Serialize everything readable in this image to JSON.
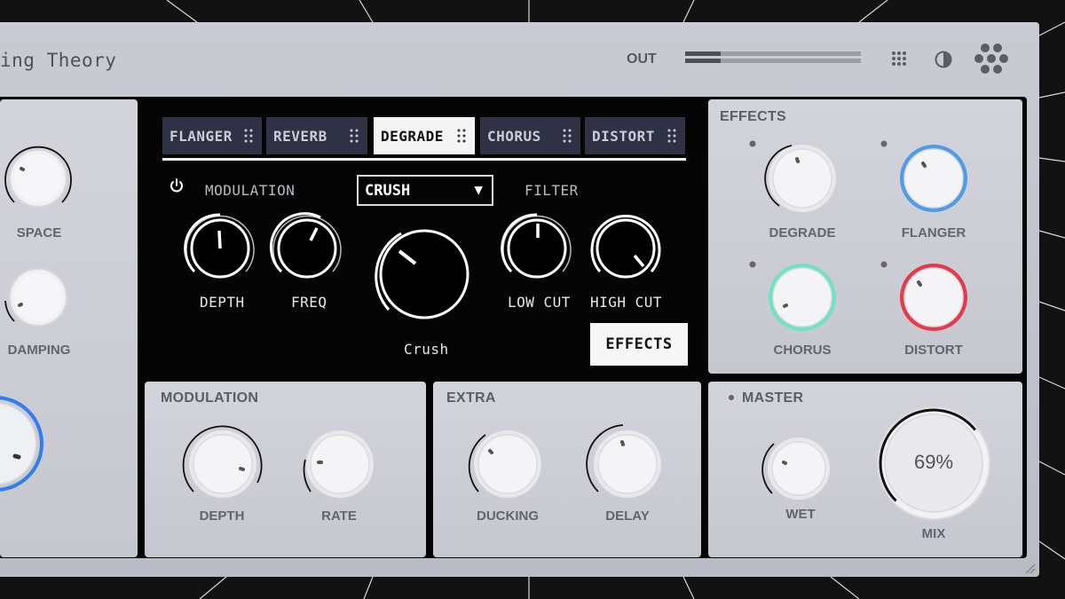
{
  "app": {
    "title": "ing Theory"
  },
  "header": {
    "out_label": "OUT",
    "out_level": 0.2,
    "icons": [
      "grid-icon",
      "contrast-icon",
      "logo-hex-icon"
    ]
  },
  "reverb_panel": {
    "knobs": [
      "SPACE",
      "DAMPING"
    ]
  },
  "tabs": [
    {
      "label": "FLANGER",
      "active": false
    },
    {
      "label": "REVERB",
      "active": false
    },
    {
      "label": "DEGRADE",
      "active": true
    },
    {
      "label": "CHORUS",
      "active": false
    },
    {
      "label": "DISTORT",
      "active": false
    }
  ],
  "degrade": {
    "modulation_label": "MODULATION",
    "filter_label": "FILTER",
    "mode": "CRUSH",
    "depth_label": "DEPTH",
    "freq_label": "FREQ",
    "crush_label": "Crush",
    "low_cut_label": "LOW CUT",
    "high_cut_label": "HIGH CUT",
    "effects_button": "EFFECTS"
  },
  "effects_card": {
    "title": "EFFECTS",
    "knobs": [
      {
        "label": "DEGRADE",
        "ring": "#e6e6ea"
      },
      {
        "label": "FLANGER",
        "ring": "#4f9be6"
      },
      {
        "label": "CHORUS",
        "ring": "#6fe3c1"
      },
      {
        "label": "DISTORT",
        "ring": "#e6394b"
      }
    ]
  },
  "modulation_card": {
    "title": "MODULATION",
    "depth_label": "DEPTH",
    "rate_label": "RATE"
  },
  "extra_card": {
    "title": "EXTRA",
    "ducking_label": "DUCKING",
    "delay_label": "DELAY"
  },
  "master_card": {
    "title": "MASTER",
    "wet_label": "WET",
    "mix_label": "MIX",
    "mix_value": "69%",
    "mix_level": 0.69
  },
  "colors": {
    "accent_blue": "#2f7df0"
  }
}
